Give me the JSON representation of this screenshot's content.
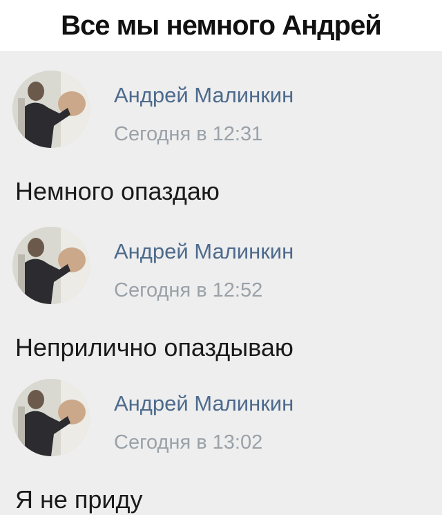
{
  "caption": "Все мы немного Андрей",
  "messages": [
    {
      "author": "Андрей Малинкин",
      "time": "Сегодня в 12:31",
      "text": "Немного опаздаю"
    },
    {
      "author": "Андрей Малинкин",
      "time": "Сегодня в 12:52",
      "text": "Неприлично опаздываю"
    },
    {
      "author": "Андрей Малинкин",
      "time": "Сегодня в 13:02",
      "text": "Я не приду"
    }
  ],
  "colors": {
    "author": "#4d6a8c",
    "time": "#9aa1a8",
    "feed_background": "#eeeeee"
  },
  "icons": {
    "avatar": "user-photo-avatar"
  }
}
